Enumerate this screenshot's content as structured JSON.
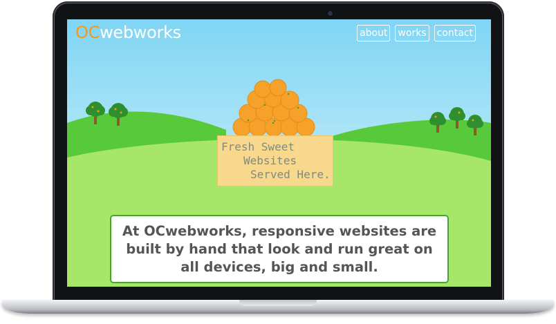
{
  "window": {
    "title": "OCwebworks"
  },
  "header": {
    "logo_accent": "OC",
    "logo_rest": "webworks",
    "nav": [
      {
        "label": "about"
      },
      {
        "label": "works"
      },
      {
        "label": "contact"
      }
    ]
  },
  "hero": {
    "crate_lines": [
      "Fresh Sweet",
      "Websites",
      "Served Here."
    ]
  },
  "intro": {
    "text": "At OCwebworks, responsive websites are built by hand that look and run great on all devices, big and small."
  },
  "colors": {
    "accent_orange": "#f39a1b",
    "sky": "#7fd5f4",
    "grass": "#a6e76a",
    "box_border": "#43a630",
    "text_gray": "#555555"
  }
}
